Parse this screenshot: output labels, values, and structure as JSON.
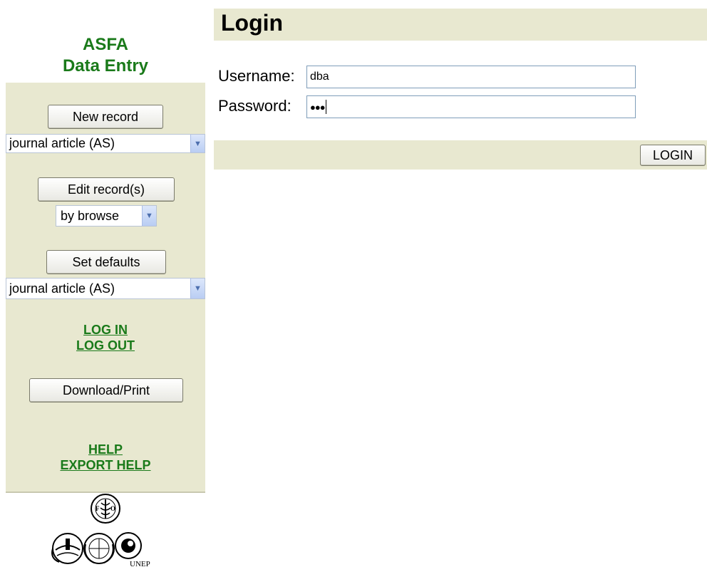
{
  "sidebar": {
    "title_line1": "ASFA",
    "title_line2": "Data Entry",
    "new_record_button": "New record",
    "new_record_type": "journal article (AS)",
    "edit_records_button": "Edit record(s)",
    "edit_mode": "by browse",
    "set_defaults_button": "Set defaults",
    "defaults_type": "journal article (AS)",
    "login_link": "LOG IN",
    "logout_link": "LOG OUT",
    "download_print_button": "Download/Print",
    "help_link": "HELP",
    "export_help_link": "EXPORT HELP",
    "logos": {
      "fao_icon": "fao-logo-icon",
      "ioc_icon": "ioc-logo-icon",
      "un_icon": "un-logo-icon",
      "unep_icon": "unep-logo-icon",
      "unep_text": "UNEP"
    }
  },
  "main": {
    "title": "Login",
    "username_label": "Username:",
    "username_value": "dba",
    "password_label": "Password:",
    "password_mask": "●●●",
    "login_button": "LOGIN"
  },
  "colors": {
    "accent_green": "#1a7a1a",
    "panel_beige": "#e8e8d0"
  }
}
